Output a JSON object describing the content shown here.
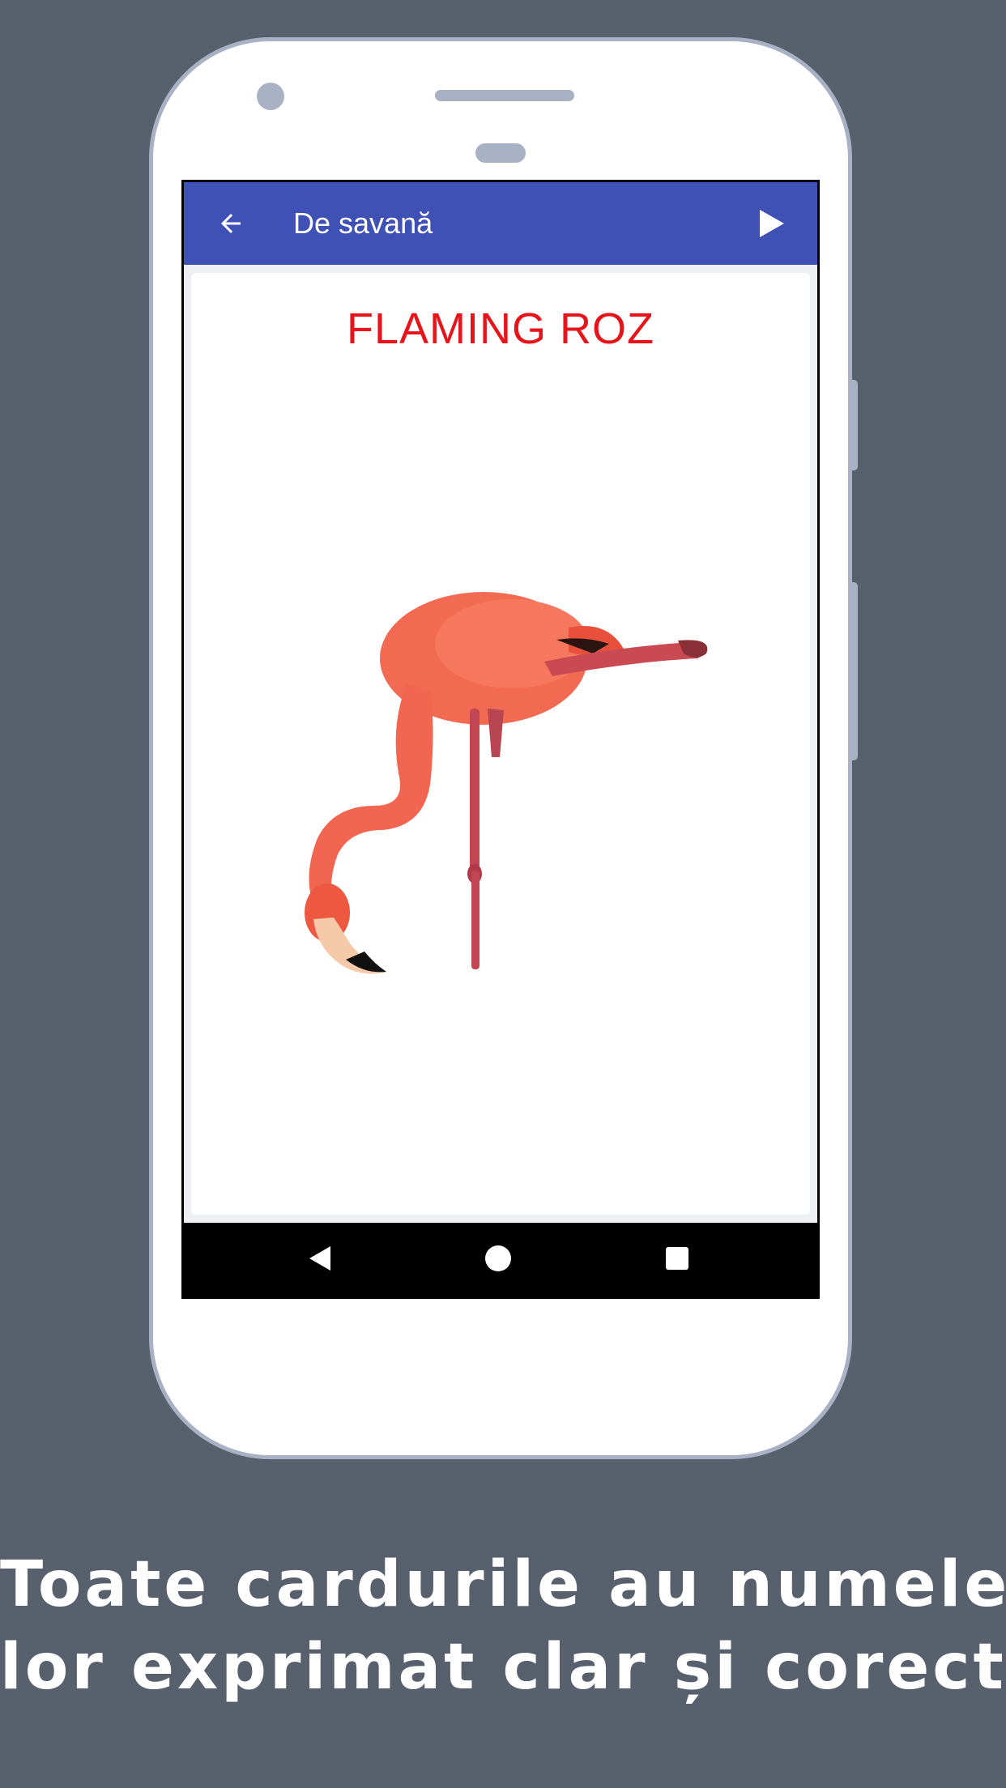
{
  "colors": {
    "background": "#58606d",
    "phone_frame": "#a9b2c4",
    "appbar": "#3f51b5",
    "title_red": "#e8141b",
    "flamingo": "#f0624d"
  },
  "appbar": {
    "back_icon": "arrow-left-icon",
    "title": "De savană",
    "play_icon": "play-icon"
  },
  "card": {
    "title": "FLAMING ROZ",
    "image": "flamingo-image"
  },
  "navbar": {
    "back_icon": "nav-back-icon",
    "home_icon": "nav-home-icon",
    "recent_icon": "nav-recent-icon"
  },
  "caption": {
    "line1": "Toate cardurile au numele",
    "line2": "lor exprimat clar și corect"
  }
}
